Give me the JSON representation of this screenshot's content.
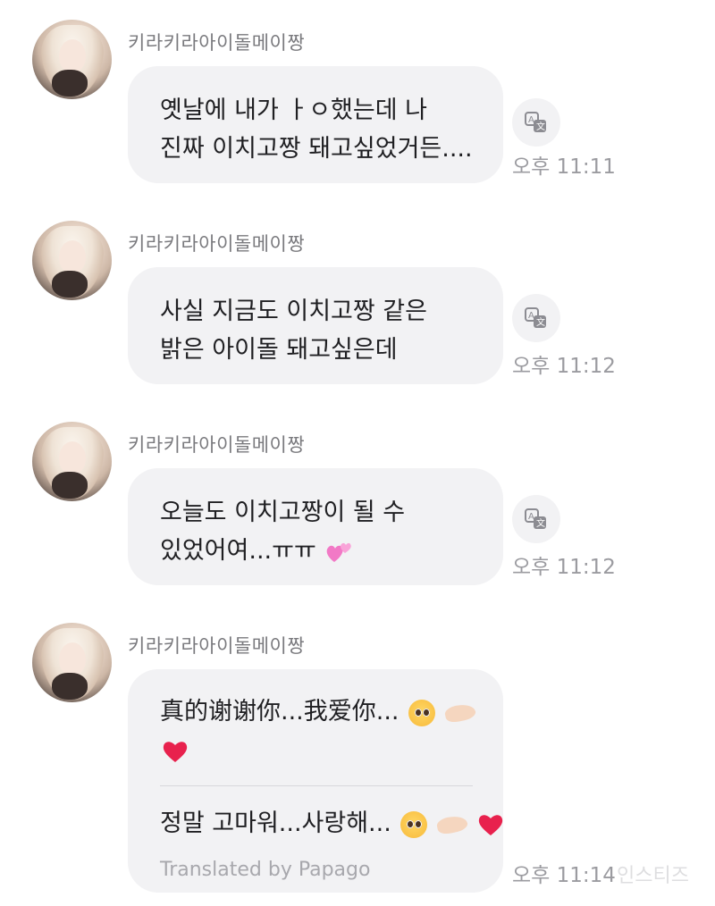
{
  "messages": [
    {
      "sender": "키라키라아이돌메이짱",
      "lines": [
        "옛날에 내가 ㅏㅇ했는데 나",
        "진짜 이치고짱 돼고싶었거든...."
      ],
      "time": "오후 11:11"
    },
    {
      "sender": "키라키라아이돌메이짱",
      "lines": [
        "사실 지금도 이치고짱 같은",
        "밝은 아이돌 돼고싶은데"
      ],
      "time": "오후 11:12"
    },
    {
      "sender": "키라키라아이돌메이짱",
      "lines": [
        "오늘도 이치고짱이 될 수",
        "있었어여...ㅠㅠ"
      ],
      "time": "오후 11:12"
    },
    {
      "sender": "키라키라아이돌메이짱",
      "original_lines": [
        "真的谢谢你...我爱你..."
      ],
      "translated_line": "정말 고마워...사랑해...",
      "translated_by": "Translated by Papago",
      "time": "오후 11:14"
    }
  ],
  "icons": {
    "translate": "translate-icon",
    "pleading_face": "pleading-face-emoji",
    "hands": "palms-up-hands-emoji",
    "heart": "red-heart-emoji",
    "two_hearts": "two-hearts-emoji"
  },
  "colors": {
    "bubble": "#f2f2f4",
    "name": "#7a7a7e",
    "time": "#9b9ba0",
    "heart": "#e8214d",
    "pink_hearts": "#f279c6"
  },
  "watermark": "인스티즈"
}
